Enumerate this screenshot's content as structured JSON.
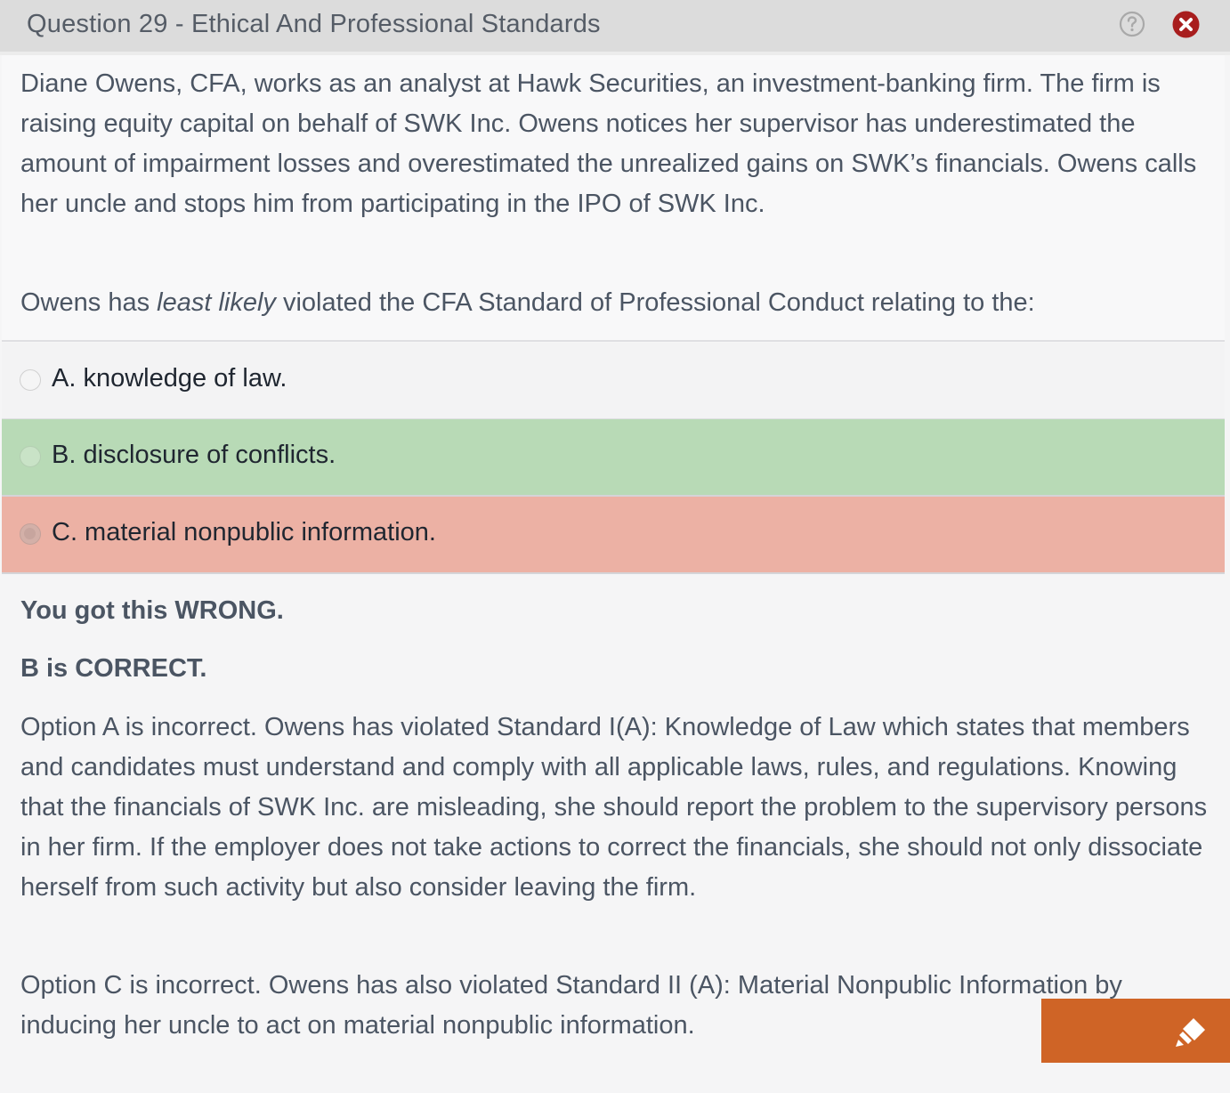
{
  "header": {
    "title": "Question 29 - Ethical And Professional Standards"
  },
  "question": {
    "stem": "Diane Owens, CFA, works as an analyst at Hawk Securities, an investment-banking firm.  The firm is raising equity capital on behalf of SWK Inc.  Owens notices her supervisor has underestimated the amount of impairment losses and overestimated the unrealized gains on SWK’s financials.  Owens calls her uncle and stops him from participating in the IPO of SWK Inc.",
    "prompt_pre": "Owens has ",
    "prompt_emphasis": "least likely",
    "prompt_post": " violated the CFA Standard of Professional Conduct relating to the:"
  },
  "options": [
    {
      "label": "A. knowledge of law.",
      "state": "neutral"
    },
    {
      "label": "B. disclosure of conflicts.",
      "state": "correct"
    },
    {
      "label": "C. material nonpublic information.",
      "state": "selected-wrong"
    }
  ],
  "explanation": {
    "result": "You got this WRONG.",
    "correct_answer": "B is CORRECT.",
    "option_a": "Option A is incorrect.  Owens has violated Standard I(A): Knowledge of Law which states that members and candidates must understand and comply with all applicable laws, rules, and regulations.  Knowing that the financials of SWK Inc. are misleading, she should report the problem to the supervisory persons in her firm.  If the employer does not take actions to correct the financials, she should not only dissociate herself from such activity but also consider leaving the firm.",
    "option_c": "Option C is incorrect.  Owens has also violated Standard II (A): Material Nonpublic Information by inducing her uncle to act on material nonpublic information."
  },
  "icons": {
    "help": "question-circle-icon",
    "close": "close-circle-icon",
    "highlighter": "highlighter-icon"
  },
  "colors": {
    "correct": "#b8dab6",
    "wrong": "#ecb1a4",
    "close": "#a81e1e",
    "highlight_button": "#cf6426"
  }
}
